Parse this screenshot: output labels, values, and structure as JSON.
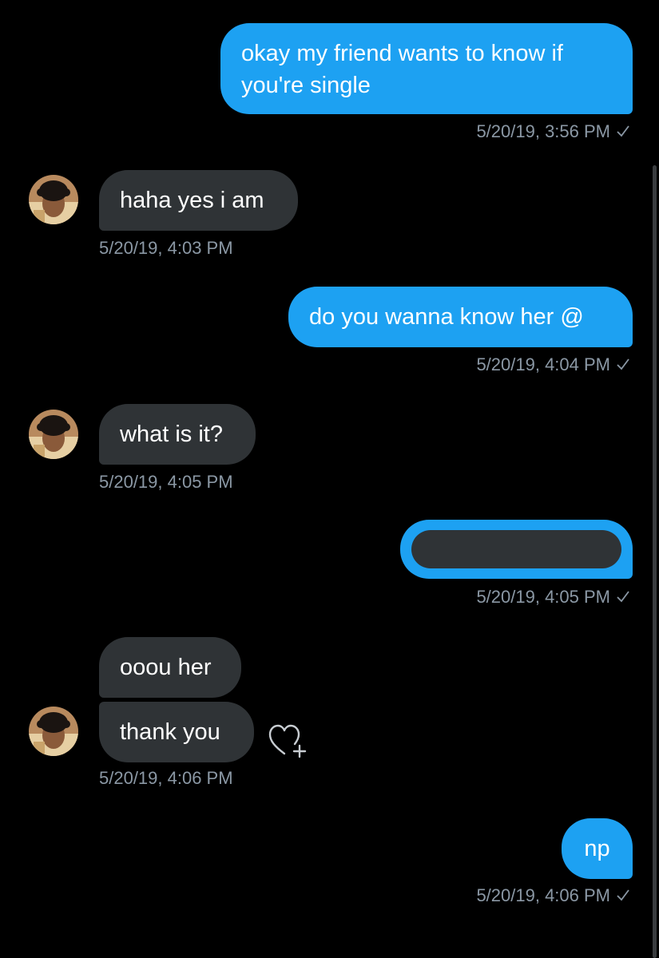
{
  "messages": [
    {
      "text_lines": [
        "okay my friend wants to know if",
        "you're single"
      ],
      "timestamp": "5/20/19, 3:56 PM"
    },
    {
      "text": "haha yes i am",
      "timestamp": "5/20/19, 4:03 PM"
    },
    {
      "text": "do you wanna know her @",
      "timestamp": "5/20/19, 4:04 PM"
    },
    {
      "text": "what is it?",
      "timestamp": "5/20/19, 4:05 PM"
    },
    {
      "text": "",
      "timestamp": "5/20/19, 4:05 PM"
    },
    {
      "text": "ooou her"
    },
    {
      "text": "thank you",
      "timestamp": "5/20/19, 4:06 PM"
    },
    {
      "text": "np",
      "timestamp": "5/20/19, 4:06 PM"
    }
  ],
  "colors": {
    "background": "#000000",
    "outgoing_bubble": "#1da1f2",
    "incoming_bubble": "#2f3336",
    "timestamp": "#8b98a5"
  },
  "icons": {
    "read_receipt": "check-icon",
    "react": "heart-add-icon",
    "avatar": "avatar"
  }
}
